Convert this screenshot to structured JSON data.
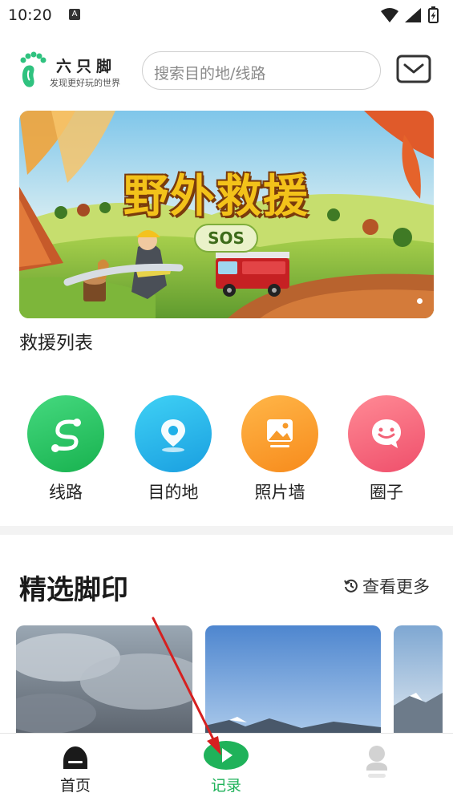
{
  "status_bar": {
    "time": "10:20",
    "notification_badge": "A"
  },
  "header": {
    "app_name": "六只脚",
    "slogan": "发现更好玩的世界",
    "search_placeholder": "搜索目的地/线路"
  },
  "banner": {
    "title": "野外救援",
    "badge": "SOS"
  },
  "rescue_list_label": "救援列表",
  "quick_actions": [
    {
      "label": "线路",
      "icon": "route-icon",
      "color": "#2ecc71"
    },
    {
      "label": "目的地",
      "icon": "location-pin-icon",
      "color": "#1fb5e8"
    },
    {
      "label": "照片墙",
      "icon": "photo-icon",
      "color": "#fb9c2a"
    },
    {
      "label": "圈子",
      "icon": "chat-smile-icon",
      "color": "#f4627a"
    }
  ],
  "featured": {
    "title": "精选脚印",
    "more_label": "查看更多"
  },
  "bottom_nav": {
    "items": [
      {
        "label": "首页",
        "icon": "home-icon"
      },
      {
        "label": "记录",
        "icon": "play-record-icon",
        "active": true
      },
      {
        "label": "",
        "icon": "profile-icon"
      }
    ],
    "active_color": "#1fb25a"
  },
  "colors": {
    "brand_green": "#1fb25a",
    "annotation_arrow": "#d62020"
  }
}
